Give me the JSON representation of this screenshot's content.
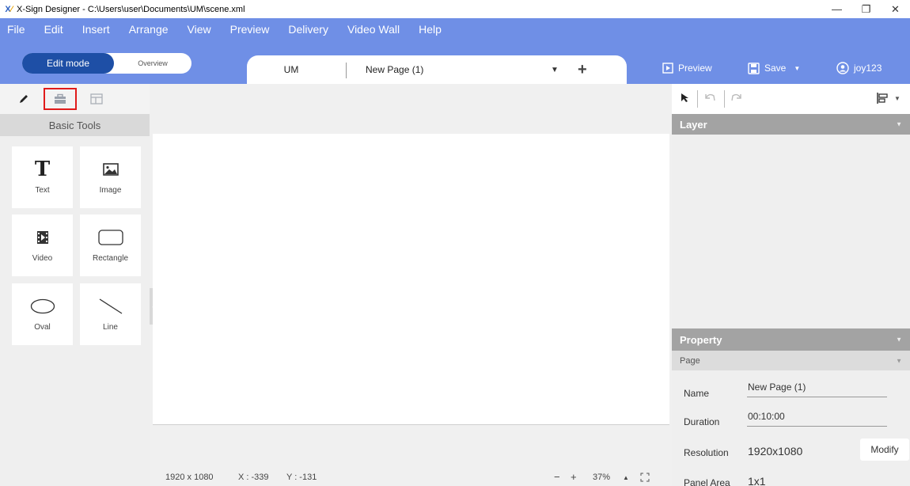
{
  "window": {
    "title": "X-Sign Designer - C:\\Users\\user\\Documents\\UM\\scene.xml",
    "controls": [
      "—",
      "❐",
      "✕"
    ]
  },
  "menu": [
    "File",
    "Edit",
    "Insert",
    "Arrange",
    "View",
    "Preview",
    "Delivery",
    "Video Wall",
    "Help"
  ],
  "mode": {
    "edit": "Edit mode",
    "overview": "Overview",
    "active": "edit"
  },
  "tabs": {
    "project": "UM",
    "page": "New Page (1)"
  },
  "header_actions": {
    "preview": "Preview",
    "save": "Save",
    "user": "joy123"
  },
  "left_panel": {
    "selected_tab": "toolbox-icon",
    "section_title": "Basic Tools",
    "tools": [
      {
        "label": "Text",
        "icon": "text-icon"
      },
      {
        "label": "Image",
        "icon": "image-icon"
      },
      {
        "label": "Video",
        "icon": "video-icon"
      },
      {
        "label": "Rectangle",
        "icon": "rectangle-icon"
      },
      {
        "label": "Oval",
        "icon": "oval-icon"
      },
      {
        "label": "Line",
        "icon": "line-icon"
      }
    ]
  },
  "status": {
    "resolution": "1920 x 1080",
    "x": "X : -339",
    "y": "Y : -131",
    "zoom_out": "−",
    "zoom_in": "+",
    "zoom": "37%"
  },
  "right_panel": {
    "layer_title": "Layer",
    "property_title": "Property",
    "page_section": "Page",
    "properties": {
      "name_label": "Name",
      "name_value": "New Page (1)",
      "duration_label": "Duration",
      "duration_value": "00:10:00",
      "resolution_label": "Resolution",
      "resolution_value": "1920x1080",
      "modify": "Modify",
      "panel_area_label": "Panel Area",
      "panel_area_value": "1x1"
    }
  },
  "colors": {
    "header": "#6f8fe6",
    "edit_mode": "#1e4fa6",
    "panel_header": "#a3a3a3",
    "highlight": "#e01b1b"
  }
}
